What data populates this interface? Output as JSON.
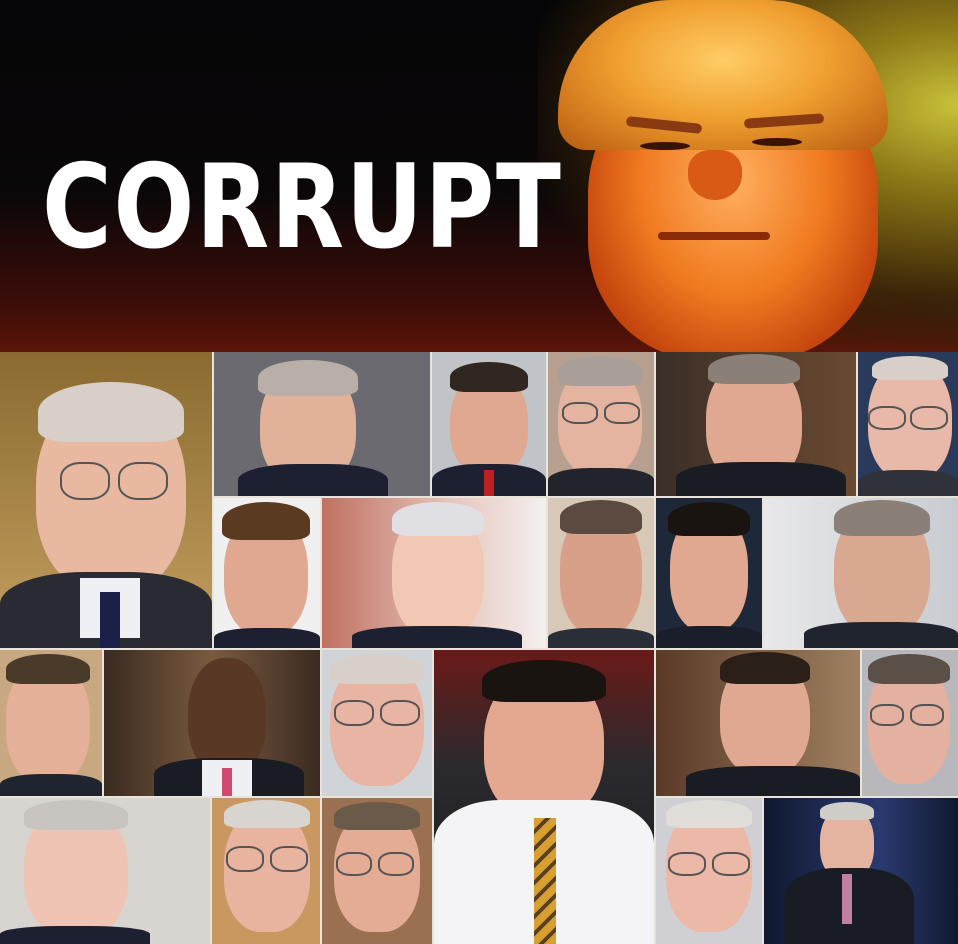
{
  "banner": {
    "headline": "CORRUPT"
  },
  "colors": {
    "headline_text": "#ffffff",
    "banner_background": "#0b0708",
    "hero_skin": "#f07a20"
  }
}
